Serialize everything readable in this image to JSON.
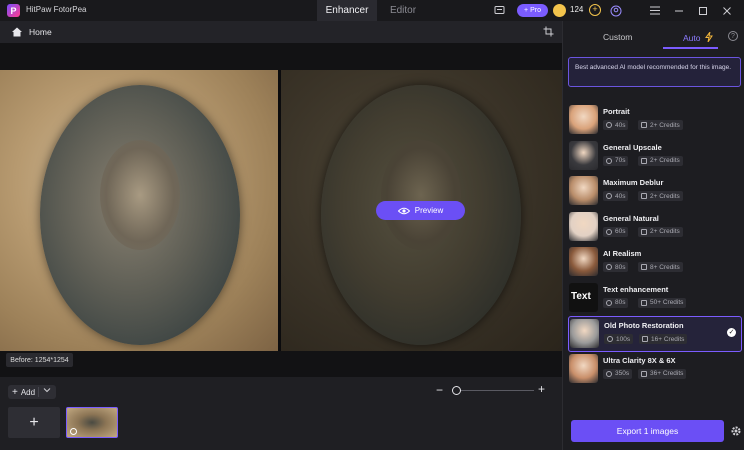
{
  "app": {
    "title": "HitPaw FotorPea",
    "logo_letter": "P"
  },
  "tabs": [
    {
      "label": "Enhancer",
      "active": true
    },
    {
      "label": "Editor",
      "active": false
    }
  ],
  "topbar": {
    "pro_label": "+ Pro",
    "credits": "124"
  },
  "breadcrumb": {
    "home_label": "Home"
  },
  "canvas": {
    "preview_label": "Preview",
    "before_label": "Before: 1254*1254"
  },
  "bottom": {
    "add_label": "Add",
    "add_tile_symbol": "+",
    "zoom_minus": "−",
    "zoom_plus": "+",
    "zoom_level": 0
  },
  "panel": {
    "tabs": [
      {
        "label": "Custom",
        "active": false
      },
      {
        "label": "Auto",
        "active": true
      }
    ],
    "help_symbol": "?",
    "info_text": "Best advanced AI model recommended for this image.",
    "models": [
      {
        "name": "Portrait",
        "time": "40s",
        "credits": "2+ Credits",
        "thumb": "#d9a27a",
        "selected": false
      },
      {
        "name": "General Upscale",
        "time": "70s",
        "credits": "2+ Credits",
        "thumb": "#3a3a3e",
        "selected": false
      },
      {
        "name": "Maximum Deblur",
        "time": "40s",
        "credits": "2+ Credits",
        "thumb": "#b98d6a",
        "selected": false
      },
      {
        "name": "General Natural",
        "time": "60s",
        "credits": "2+ Credits",
        "thumb": "#e2d1c4",
        "selected": false
      },
      {
        "name": "AI Realism",
        "time": "80s",
        "credits": "8+ Credits",
        "thumb": "#8a5a3c",
        "selected": false
      },
      {
        "name": "Text enhancement",
        "time": "80s",
        "credits": "50+ Credits",
        "thumb": "#111111",
        "thumb_text": "Text",
        "selected": false
      },
      {
        "name": "Old Photo Restoration",
        "time": "100s",
        "credits": "16+ Credits",
        "thumb": "#9a9a9a",
        "selected": true
      },
      {
        "name": "Ultra Clarity 8X & 6X",
        "time": "350s",
        "credits": "36+ Credits",
        "thumb": "#c98f6a",
        "selected": false
      }
    ],
    "export_label": "Export 1 images"
  },
  "colors": {
    "accent": "#6b4ff5",
    "panel_bg": "#1d1d21",
    "canvas_bg": "#121214"
  }
}
